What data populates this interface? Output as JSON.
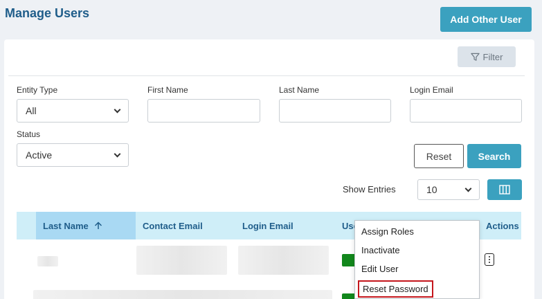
{
  "header": {
    "title": "Manage Users",
    "add_button": "Add Other User"
  },
  "filter": {
    "button_label": "Filter"
  },
  "form": {
    "entity_type": {
      "label": "Entity Type",
      "value": "All"
    },
    "first_name": {
      "label": "First Name",
      "value": ""
    },
    "last_name": {
      "label": "Last Name",
      "value": ""
    },
    "login_email": {
      "label": "Login Email",
      "value": ""
    },
    "status": {
      "label": "Status",
      "value": "Active"
    },
    "reset_label": "Reset",
    "search_label": "Search"
  },
  "entries": {
    "label": "Show Entries",
    "value": "10"
  },
  "table": {
    "columns": [
      "Last Name",
      "Contact Email",
      "Login Email",
      "Use",
      "Actions"
    ]
  },
  "menu": {
    "items": [
      "Assign Roles",
      "Inactivate",
      "Edit User",
      "Reset Password"
    ]
  },
  "colors": {
    "accent": "#3ba1bf",
    "title": "#1f5d8a",
    "header_bg": "#cfeef8",
    "status_active": "#12871c",
    "highlight_border": "#c4161c"
  }
}
